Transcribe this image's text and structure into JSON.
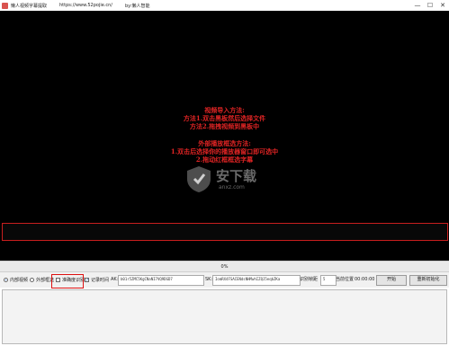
{
  "titlebar": {
    "app_name": "懒人视频字幕提取",
    "url": "https://www.52pojie.cn/",
    "author": "by:懒人智能",
    "minimize": "—",
    "maximize": "☐",
    "close": "✕"
  },
  "video": {
    "instructions": [
      "视频导入方法:",
      "方法1.双击黑板然后选择文件",
      "方法2.拖拽视频到黑板中",
      "",
      "外部播放框选方法:",
      "1.双击后选择你的播放器窗口即可选中",
      "2.拖动红框框选字幕"
    ],
    "watermark_text": "安下载",
    "watermark_sub": "anxz.com"
  },
  "progress": {
    "percent_text": "0%"
  },
  "controls": {
    "internal_video": "内部视频",
    "external_frame": "外部框选",
    "fine_recognition": "准确度识别",
    "record_time": "记录时间",
    "ak_label": "AK:",
    "ak_value": "b01r5ZMC5KgCNaNI7VQ9DGD7",
    "sk_label": "SK:",
    "sk_value": "IomRX4FSACENdsNHMwhIZQJ5eqbZKa",
    "frame_interval_label": "识别帧距",
    "frame_interval_value": "5",
    "current_position_label": "当前位置",
    "current_position_value": "00:00:00",
    "start_button": "开始",
    "reset_button": "重新初始化"
  }
}
